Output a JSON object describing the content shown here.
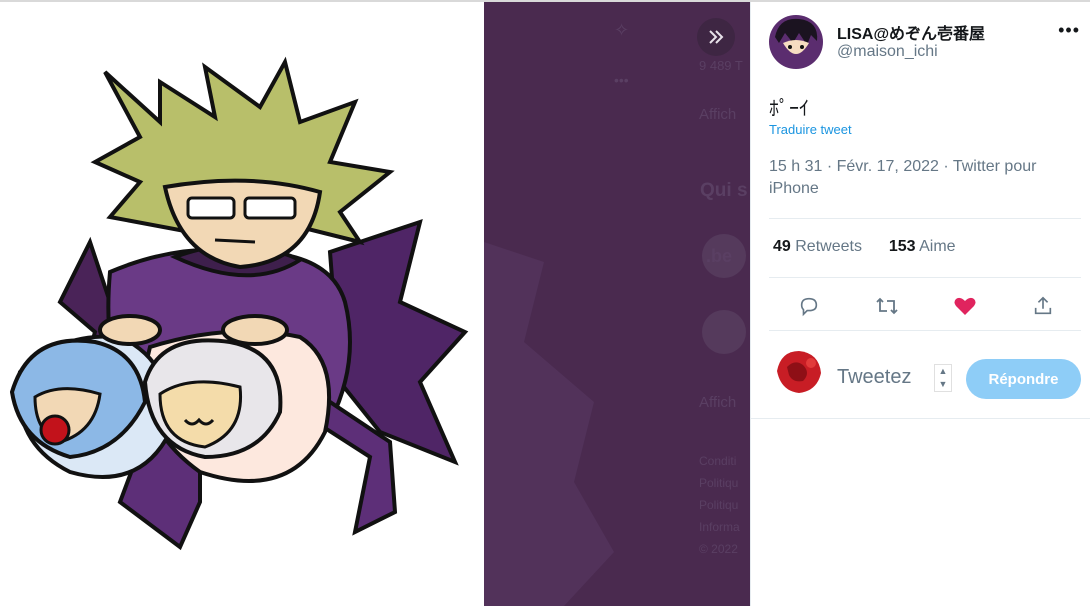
{
  "tweet": {
    "display_name": "LISA@めぞん壱番屋",
    "handle": "@maison_ichi",
    "text": "ﾎﾟｰｲ",
    "translate_label": "Traduire tweet",
    "time": "15 h 31",
    "date": "Févr. 17, 2022",
    "client": "Twitter pour iPhone",
    "retweets_count": "49",
    "retweets_label": "Retweets",
    "likes_count": "153",
    "likes_label": "Aime",
    "liked": true,
    "like_color": "#e0245e"
  },
  "reply": {
    "placeholder": "Tweetez",
    "button_label": "Répondre",
    "button_color": "#8ecdf7"
  },
  "background_ui": {
    "count_fragment": "9 489 T",
    "show_more_fragment": "Affich",
    "who_to_follow_fragment": "Qui s",
    "account_fragment": ".be",
    "show_more_fragment_2": "Affich",
    "footer_lines": [
      "Conditi",
      "Politiqu",
      "Politiqu",
      "Informa",
      "© 2022"
    ]
  },
  "icons": {
    "expand": "double-chevron-right-icon",
    "more": "more-horizontal-icon",
    "reply": "reply-bubble-icon",
    "retweet": "retweet-icon",
    "like": "heart-icon",
    "share": "share-icon",
    "sparkle": "sparkle-icon"
  }
}
